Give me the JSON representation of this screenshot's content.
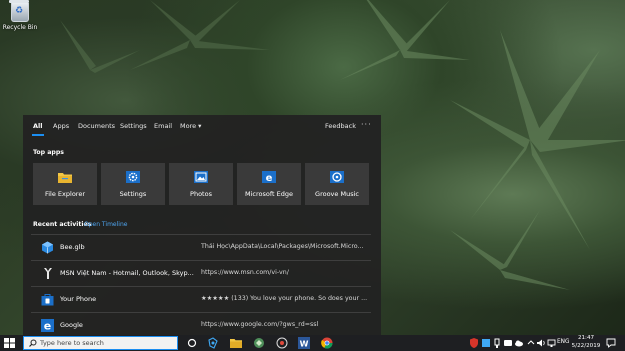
{
  "desktop": {
    "recycle_bin_label": "Recycle Bin"
  },
  "search_panel": {
    "tabs": [
      {
        "label": "All",
        "active": true
      },
      {
        "label": "Apps"
      },
      {
        "label": "Documents"
      },
      {
        "label": "Settings"
      },
      {
        "label": "Email"
      },
      {
        "label": "More ▾"
      }
    ],
    "feedback_label": "Feedback",
    "ellipsis": "···",
    "top_apps_title": "Top apps",
    "top_apps": [
      {
        "name": "File Explorer",
        "icon": "folder-icon"
      },
      {
        "name": "Settings",
        "icon": "gear-icon"
      },
      {
        "name": "Photos",
        "icon": "photos-icon"
      },
      {
        "name": "Microsoft Edge",
        "icon": "edge-icon"
      },
      {
        "name": "Groove Music",
        "icon": "groove-music-icon"
      }
    ],
    "recent_title": "Recent activities",
    "open_timeline_label": "Open Timeline",
    "recent_activities": [
      {
        "title": "Bee.glb",
        "detail": "Thái Học\\AppData\\Local\\Packages\\Microsoft.Micro...",
        "icon": "3d-cube-icon"
      },
      {
        "title": "MSN Việt Nam - Hotmail, Outlook, Skyp...",
        "detail": "https://www.msn.com/vi-vn/",
        "icon": "cortana-icon"
      },
      {
        "title": "Your Phone",
        "detail": "★★★★★ (133) You love your phone. So does your ...",
        "icon": "store-icon"
      },
      {
        "title": "Google",
        "detail": "https://www.google.com/?gws_rd=ssl",
        "icon": "edge-icon"
      }
    ]
  },
  "taskbar": {
    "search_placeholder": "Type here to search",
    "language": "ENG",
    "time": "21:47",
    "date": "5/22/2019"
  },
  "colors": {
    "accent": "#1b8ef2",
    "panel_bg": "#222222",
    "tile_bg": "#3a3a3a",
    "link": "#4ea5f0"
  }
}
